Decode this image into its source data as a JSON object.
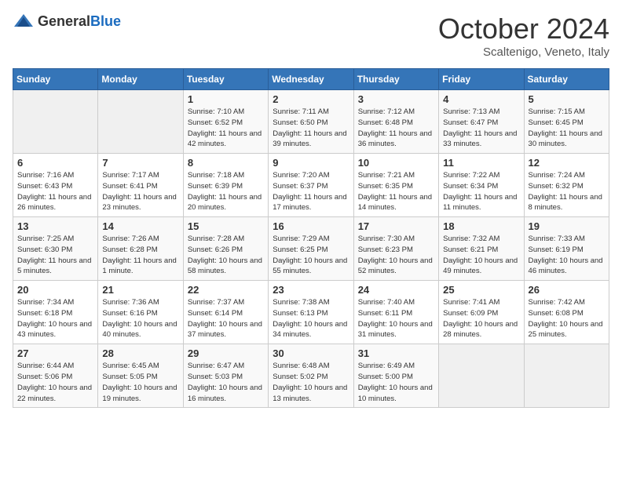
{
  "header": {
    "logo_general": "General",
    "logo_blue": "Blue",
    "month": "October 2024",
    "location": "Scaltenigo, Veneto, Italy"
  },
  "weekdays": [
    "Sunday",
    "Monday",
    "Tuesday",
    "Wednesday",
    "Thursday",
    "Friday",
    "Saturday"
  ],
  "weeks": [
    [
      {
        "day": "",
        "empty": true
      },
      {
        "day": "",
        "empty": true
      },
      {
        "day": "1",
        "sunrise": "7:10 AM",
        "sunset": "6:52 PM",
        "daylight": "11 hours and 42 minutes."
      },
      {
        "day": "2",
        "sunrise": "7:11 AM",
        "sunset": "6:50 PM",
        "daylight": "11 hours and 39 minutes."
      },
      {
        "day": "3",
        "sunrise": "7:12 AM",
        "sunset": "6:48 PM",
        "daylight": "11 hours and 36 minutes."
      },
      {
        "day": "4",
        "sunrise": "7:13 AM",
        "sunset": "6:47 PM",
        "daylight": "11 hours and 33 minutes."
      },
      {
        "day": "5",
        "sunrise": "7:15 AM",
        "sunset": "6:45 PM",
        "daylight": "11 hours and 30 minutes."
      }
    ],
    [
      {
        "day": "6",
        "sunrise": "7:16 AM",
        "sunset": "6:43 PM",
        "daylight": "11 hours and 26 minutes."
      },
      {
        "day": "7",
        "sunrise": "7:17 AM",
        "sunset": "6:41 PM",
        "daylight": "11 hours and 23 minutes."
      },
      {
        "day": "8",
        "sunrise": "7:18 AM",
        "sunset": "6:39 PM",
        "daylight": "11 hours and 20 minutes."
      },
      {
        "day": "9",
        "sunrise": "7:20 AM",
        "sunset": "6:37 PM",
        "daylight": "11 hours and 17 minutes."
      },
      {
        "day": "10",
        "sunrise": "7:21 AM",
        "sunset": "6:35 PM",
        "daylight": "11 hours and 14 minutes."
      },
      {
        "day": "11",
        "sunrise": "7:22 AM",
        "sunset": "6:34 PM",
        "daylight": "11 hours and 11 minutes."
      },
      {
        "day": "12",
        "sunrise": "7:24 AM",
        "sunset": "6:32 PM",
        "daylight": "11 hours and 8 minutes."
      }
    ],
    [
      {
        "day": "13",
        "sunrise": "7:25 AM",
        "sunset": "6:30 PM",
        "daylight": "11 hours and 5 minutes."
      },
      {
        "day": "14",
        "sunrise": "7:26 AM",
        "sunset": "6:28 PM",
        "daylight": "11 hours and 1 minute."
      },
      {
        "day": "15",
        "sunrise": "7:28 AM",
        "sunset": "6:26 PM",
        "daylight": "10 hours and 58 minutes."
      },
      {
        "day": "16",
        "sunrise": "7:29 AM",
        "sunset": "6:25 PM",
        "daylight": "10 hours and 55 minutes."
      },
      {
        "day": "17",
        "sunrise": "7:30 AM",
        "sunset": "6:23 PM",
        "daylight": "10 hours and 52 minutes."
      },
      {
        "day": "18",
        "sunrise": "7:32 AM",
        "sunset": "6:21 PM",
        "daylight": "10 hours and 49 minutes."
      },
      {
        "day": "19",
        "sunrise": "7:33 AM",
        "sunset": "6:19 PM",
        "daylight": "10 hours and 46 minutes."
      }
    ],
    [
      {
        "day": "20",
        "sunrise": "7:34 AM",
        "sunset": "6:18 PM",
        "daylight": "10 hours and 43 minutes."
      },
      {
        "day": "21",
        "sunrise": "7:36 AM",
        "sunset": "6:16 PM",
        "daylight": "10 hours and 40 minutes."
      },
      {
        "day": "22",
        "sunrise": "7:37 AM",
        "sunset": "6:14 PM",
        "daylight": "10 hours and 37 minutes."
      },
      {
        "day": "23",
        "sunrise": "7:38 AM",
        "sunset": "6:13 PM",
        "daylight": "10 hours and 34 minutes."
      },
      {
        "day": "24",
        "sunrise": "7:40 AM",
        "sunset": "6:11 PM",
        "daylight": "10 hours and 31 minutes."
      },
      {
        "day": "25",
        "sunrise": "7:41 AM",
        "sunset": "6:09 PM",
        "daylight": "10 hours and 28 minutes."
      },
      {
        "day": "26",
        "sunrise": "7:42 AM",
        "sunset": "6:08 PM",
        "daylight": "10 hours and 25 minutes."
      }
    ],
    [
      {
        "day": "27",
        "sunrise": "6:44 AM",
        "sunset": "5:06 PM",
        "daylight": "10 hours and 22 minutes."
      },
      {
        "day": "28",
        "sunrise": "6:45 AM",
        "sunset": "5:05 PM",
        "daylight": "10 hours and 19 minutes."
      },
      {
        "day": "29",
        "sunrise": "6:47 AM",
        "sunset": "5:03 PM",
        "daylight": "10 hours and 16 minutes."
      },
      {
        "day": "30",
        "sunrise": "6:48 AM",
        "sunset": "5:02 PM",
        "daylight": "10 hours and 13 minutes."
      },
      {
        "day": "31",
        "sunrise": "6:49 AM",
        "sunset": "5:00 PM",
        "daylight": "10 hours and 10 minutes."
      },
      {
        "day": "",
        "empty": true
      },
      {
        "day": "",
        "empty": true
      }
    ]
  ]
}
